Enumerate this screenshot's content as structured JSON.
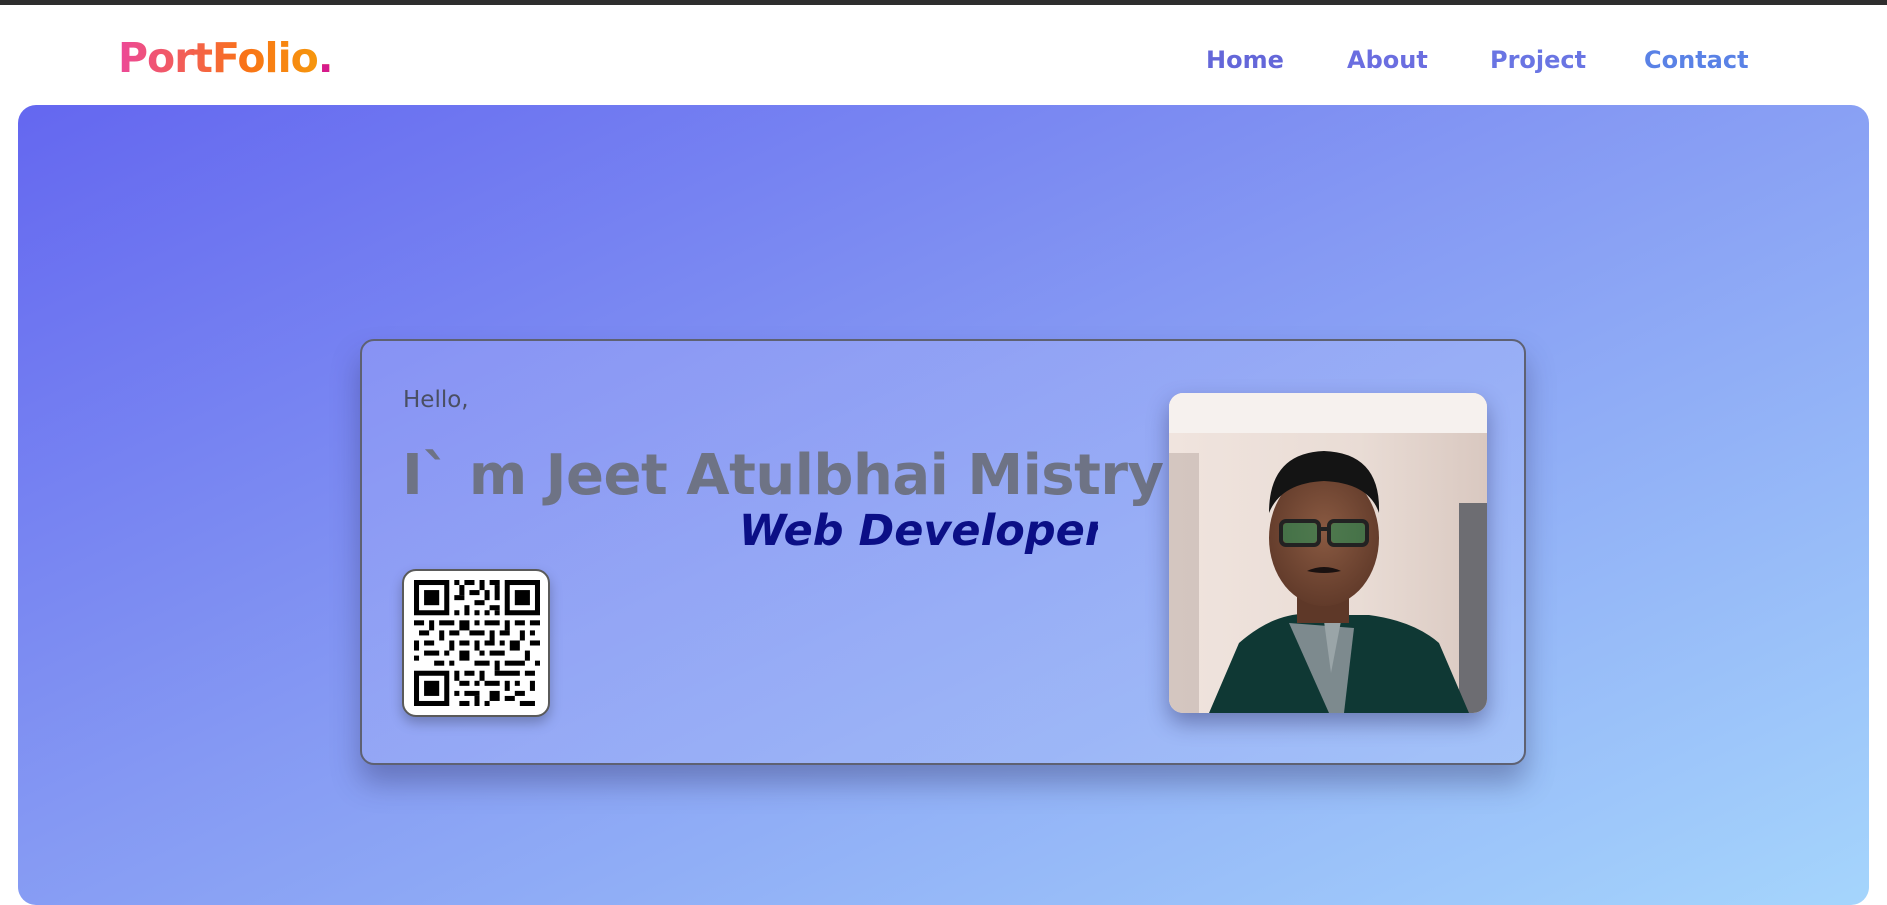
{
  "navbar": {
    "logo_text": "PortFolio",
    "logo_dot": ".",
    "links": [
      {
        "label": "Home"
      },
      {
        "label": "About"
      },
      {
        "label": "Project"
      },
      {
        "label": "Contact"
      }
    ]
  },
  "hero": {
    "greeting": "Hello,",
    "headline": "I` m Jeet Atulbhai Mistry",
    "role": "Web Developer",
    "qr_icon": "qr-code-icon",
    "photo_icon": "profile-photo"
  },
  "colors": {
    "hero_gradient_start": "#6467f0",
    "hero_gradient_end": "#a5d5fc",
    "role_text": "#0b0f86",
    "logo_gradient_start": "#ec4899",
    "logo_gradient_end": "#f59e0b"
  }
}
